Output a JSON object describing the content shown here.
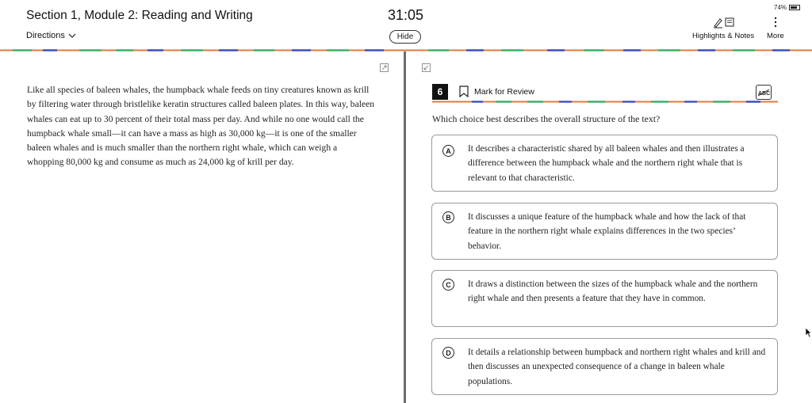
{
  "header": {
    "section_title": "Section 1, Module 2: Reading and Writing",
    "directions_label": "Directions",
    "timer": "31:05",
    "hide_label": "Hide",
    "battery_percent": "74%",
    "highlights_label": "Highlights & Notes",
    "more_label": "More"
  },
  "passage": {
    "text": "Like all species of baleen whales, the humpback whale feeds on tiny creatures known as krill by filtering water through bristlelike keratin structures called baleen plates. In this way, baleen whales can eat up to 30 percent of their total mass per day. And while no one would call the humpback whale small—it can have a mass as high as 30,000 kg—it is one of the smaller baleen whales and is much smaller than the northern right whale, which can weigh a whopping 80,000 kg and consume as much as 24,000 kg of krill per day."
  },
  "question": {
    "number": "6",
    "mark_label": "Mark for Review",
    "prompt": "Which choice best describes the overall structure of the text?",
    "choices": [
      {
        "letter": "A",
        "text": "It describes a characteristic shared by all baleen whales and then illustrates a difference between the humpback whale and the northern right whale that is relevant to that characteristic."
      },
      {
        "letter": "B",
        "text": "It discusses a unique feature of the humpback whale and how the lack of that feature in the northern right whale explains differences in the two species’ behavior."
      },
      {
        "letter": "C",
        "text": "It draws a distinction between the sizes of the humpback whale and the northern right whale and then presents a feature that they have in common."
      },
      {
        "letter": "D",
        "text": "It details a relationship between humpback and northern right whales and krill and then discusses an unexpected consequence of a change in baleen whale populations."
      }
    ]
  },
  "colors": {
    "dash_blue": "#3b4fb8",
    "dash_green": "#3fae6b",
    "dash_orange": "#e07a3c",
    "divider": "#6b6b6b"
  },
  "icons": {
    "directions": "chevron-down-icon",
    "highlights": "pen-notes-icon",
    "more": "more-vertical-icon",
    "bookmark": "bookmark-icon",
    "abc": "abc-eliminator-icon",
    "expand": "expand-icon"
  }
}
